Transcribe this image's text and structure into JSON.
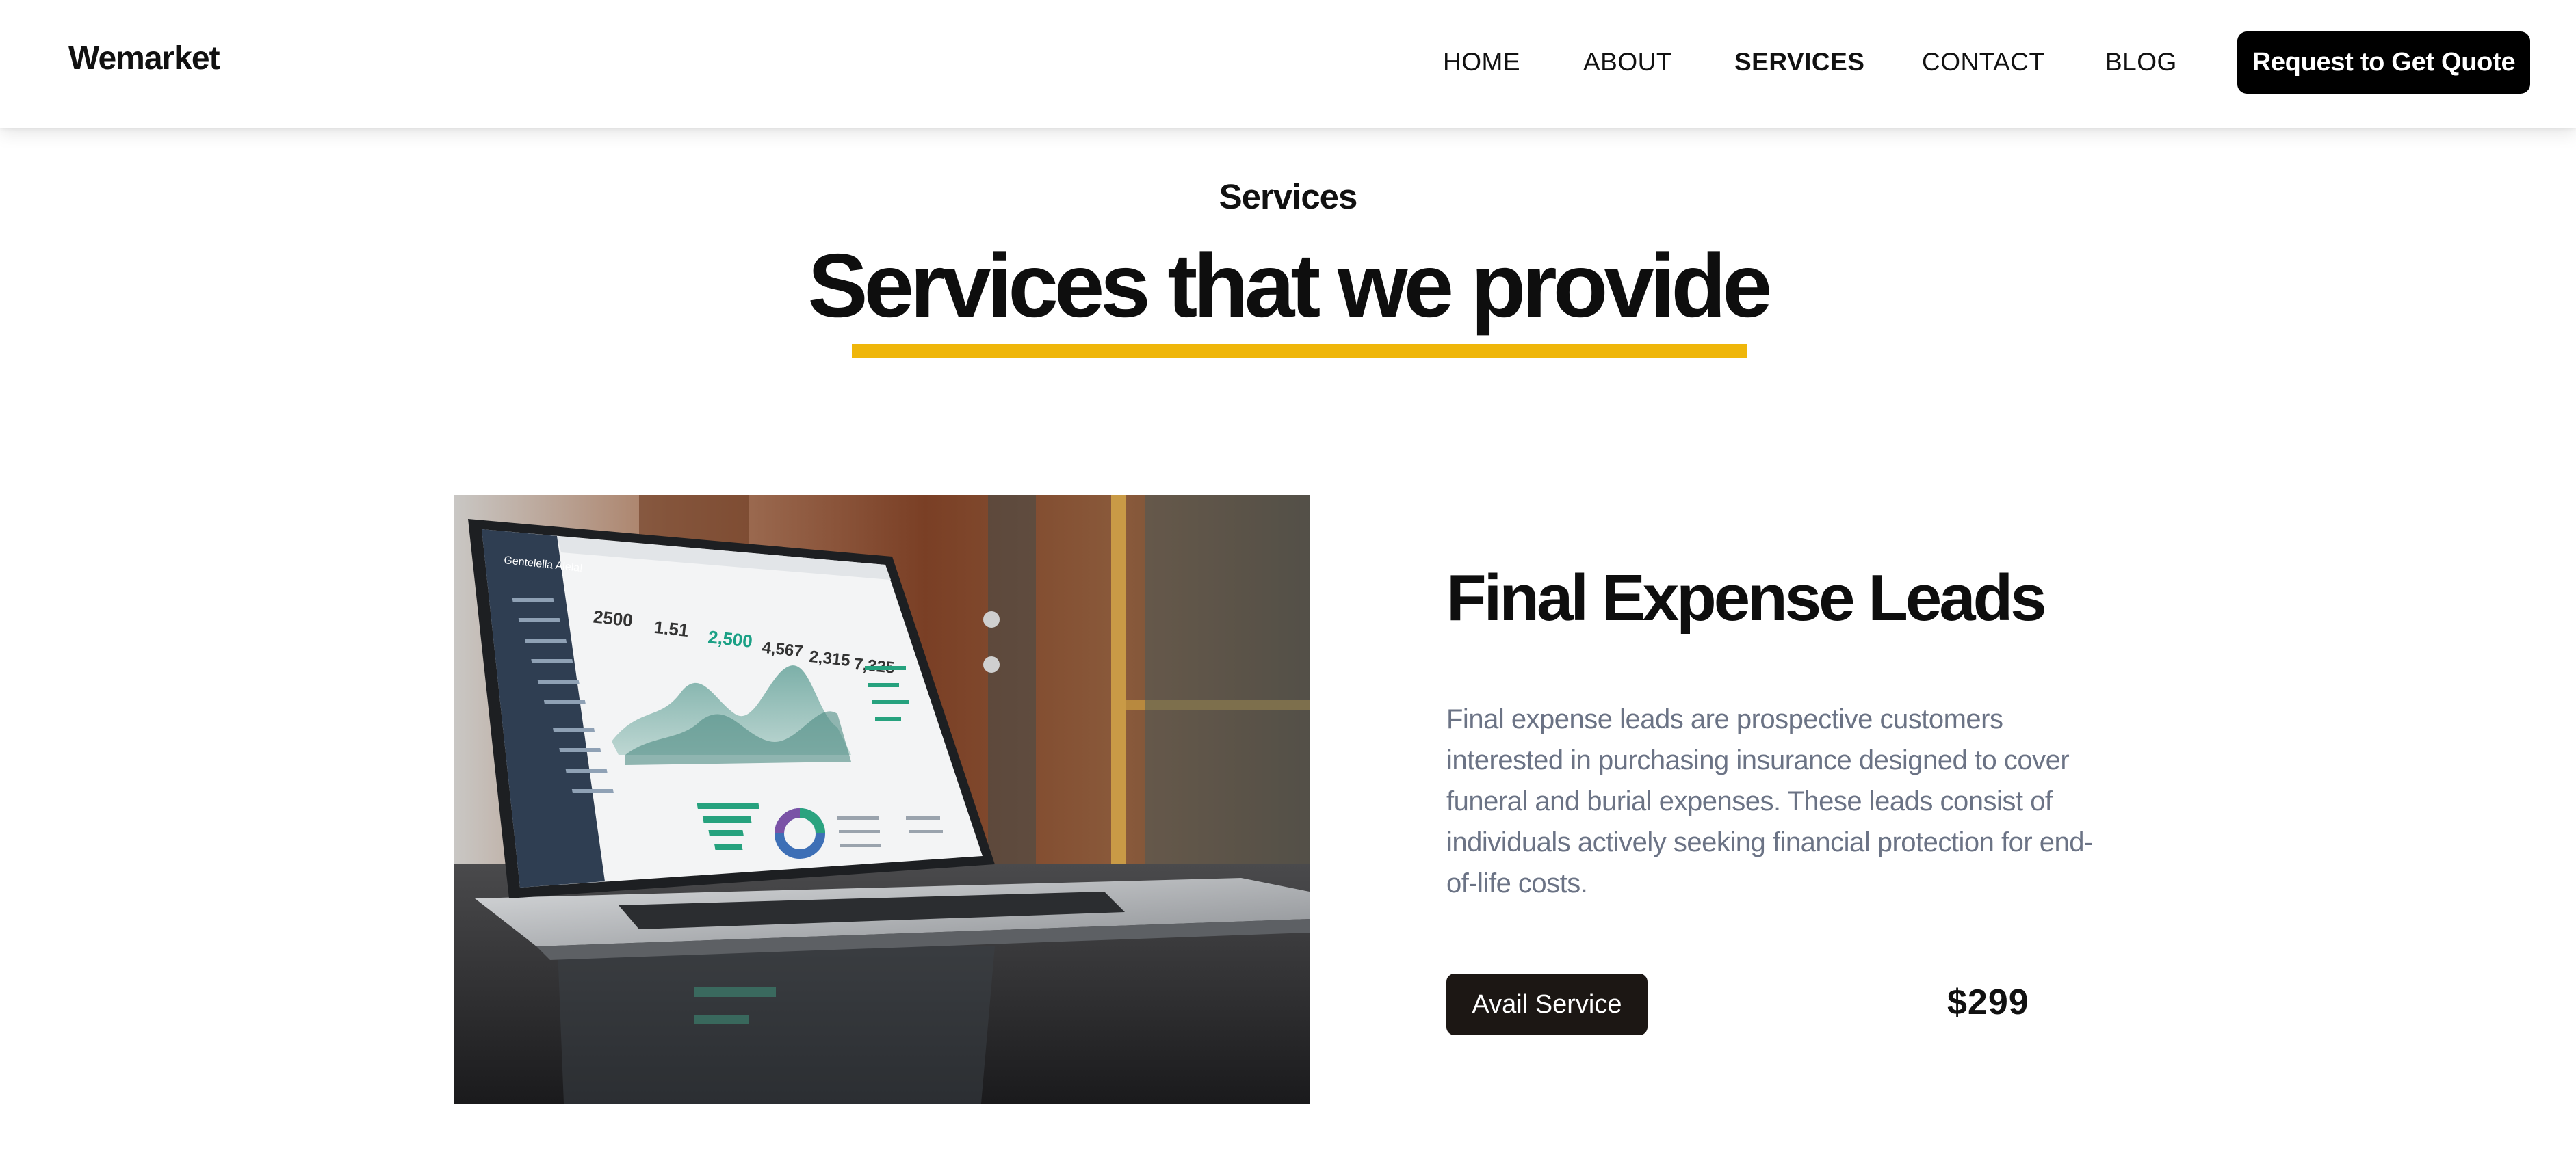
{
  "header": {
    "brand": "Wemarket",
    "nav": [
      "HOME",
      "ABOUT",
      "SERVICES",
      "CONTACT",
      "BLOG"
    ],
    "active_nav": "SERVICES",
    "cta_label": "Request to Get Quote"
  },
  "section": {
    "eyebrow": "Services",
    "headline": "Services that we provide",
    "accent_color": "#efb60a"
  },
  "service": {
    "title": "Final Expense Leads",
    "description": "Final expense leads are prospective customers interested in purchasing insurance designed to cover funeral and burial expenses. These leads consist of individuals actively seeking financial protection for end-of-life costs.",
    "button_label": "Avail Service",
    "price": "$299",
    "image": "laptop-analytics-dashboard-photo"
  },
  "dashboard": {
    "app_name": "Gentelella Alela!",
    "stats": [
      "2500",
      "1.51",
      "2,500",
      "4,567",
      "2,315",
      "7,325"
    ]
  }
}
